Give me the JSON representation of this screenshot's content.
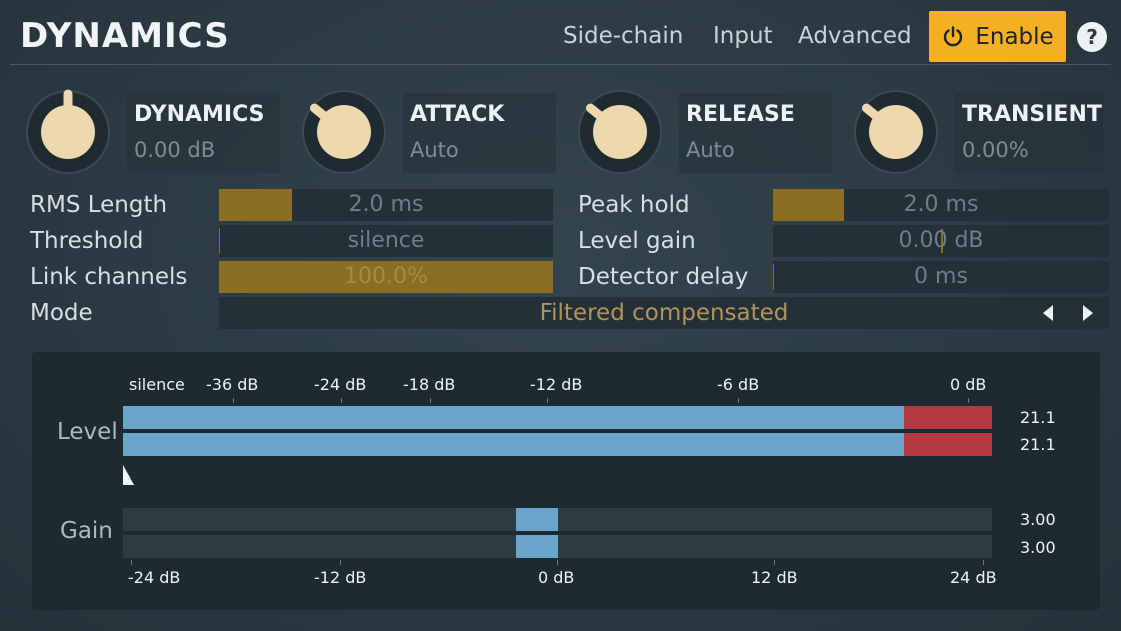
{
  "header": {
    "title": "DYNAMICS",
    "tabs": [
      "Side-chain",
      "Input",
      "Advanced"
    ],
    "enable_label": "Enable",
    "help_label": "?"
  },
  "knobs": [
    {
      "name": "DYNAMICS",
      "value": "0.00 dB",
      "level": 0.5
    },
    {
      "name": "ATTACK",
      "value": "Auto",
      "level": 0.33
    },
    {
      "name": "RELEASE",
      "value": "Auto",
      "level": 0.33
    },
    {
      "name": "TRANSIENT",
      "value": "0.00%",
      "level": 0.33
    }
  ],
  "params": {
    "rms_length": {
      "label": "RMS Length",
      "value": "2.0 ms",
      "fill": 0.22
    },
    "threshold": {
      "label": "Threshold",
      "value": "silence",
      "fill": 0.0
    },
    "link_channels": {
      "label": "Link channels",
      "value": "100.0%",
      "fill": 1.0
    },
    "peak_hold": {
      "label": "Peak hold",
      "value": "2.0 ms",
      "fill": 0.21
    },
    "level_gain": {
      "label": "Level gain",
      "value": "0.00 dB",
      "fill": 0.5
    },
    "detector_delay": {
      "label": "Detector delay",
      "value": "0 ms",
      "fill": 0.0
    },
    "mode": {
      "label": "Mode",
      "value": "Filtered compensated"
    }
  },
  "meters": {
    "level_label": "Level",
    "gain_label": "Gain",
    "level_scale": [
      "silence",
      "-36 dB",
      "-24 dB",
      "-18 dB",
      "-12 dB",
      "-6 dB",
      "0 dB"
    ],
    "gain_scale": [
      "-24 dB",
      "-12 dB",
      "0 dB",
      "12 dB",
      "24 dB"
    ],
    "level_values": [
      "21.1",
      "21.1"
    ],
    "gain_values": [
      "3.00",
      "3.00"
    ]
  },
  "colors": {
    "accent": "#f4b021",
    "slider_fill": "#8c6e22",
    "meter_blue": "#6aa6cc",
    "meter_red": "#b23a40"
  }
}
